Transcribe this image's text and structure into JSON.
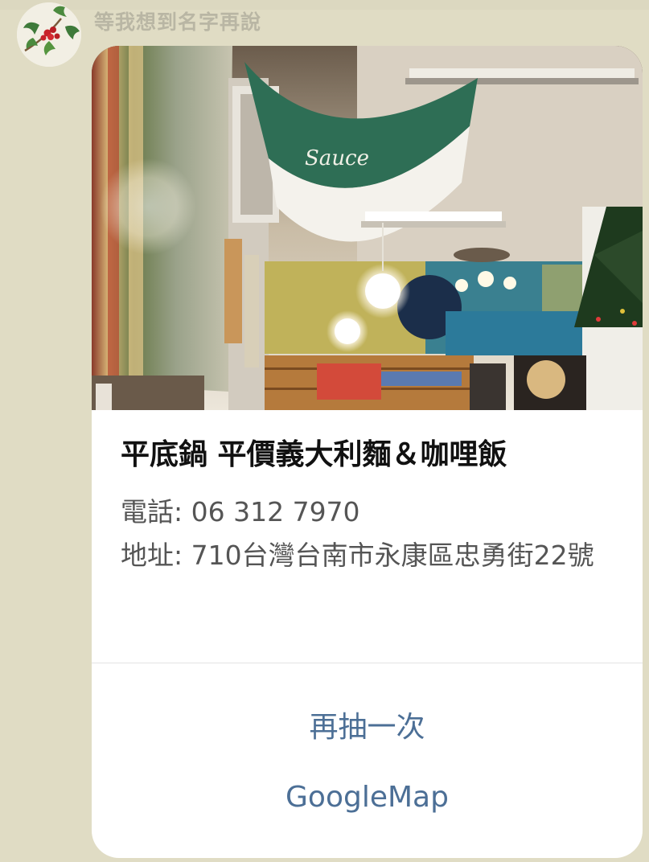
{
  "chat": {
    "sender_name": "等我想到名字再說",
    "avatar_icon": "holly-berry-icon"
  },
  "card": {
    "image_icon": "restaurant-interior-photo",
    "title": "平底鍋 平價義大利麵＆咖哩飯",
    "phone_label": "電話: ",
    "phone": "06 312 7970",
    "address_label": "地址: ",
    "address": "710台灣台南市永康區忠勇街22號",
    "actions": {
      "redraw_label": "再抽一次",
      "map_label": "GoogleMap"
    }
  },
  "colors": {
    "background": "#e0dcc4",
    "action_text": "#4c6f96",
    "sender_name": "#b9b6a4"
  }
}
